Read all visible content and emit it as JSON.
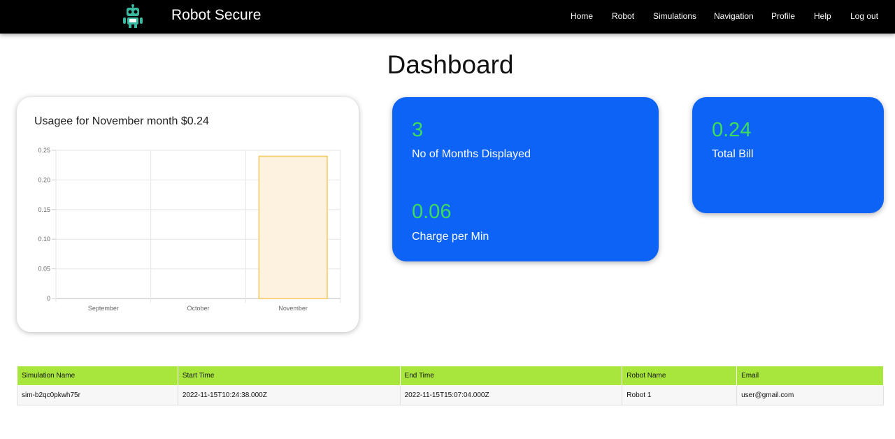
{
  "navbar": {
    "brand": "Robot Secure",
    "links": [
      "Home",
      "Robot",
      "Simulations",
      "Navigation",
      "Profile",
      "Help",
      "Log out"
    ]
  },
  "page_title": "Dashboard",
  "usage_card": {
    "title": "Usagee for November month $0.24"
  },
  "chart_data": {
    "type": "bar",
    "categories": [
      "September",
      "October",
      "November"
    ],
    "values": [
      0,
      0,
      0.24
    ],
    "ylim": [
      0,
      0.25
    ],
    "y_ticks": [
      "0",
      "0.05",
      "0.10",
      "0.15",
      "0.20",
      "0.25"
    ],
    "y_tick_values": [
      0,
      0.05,
      0.1,
      0.15,
      0.2,
      0.25
    ],
    "grid": true,
    "bar_fill": "#fdf2df",
    "bar_border": "#f5c85a"
  },
  "stats": {
    "months_value": "3",
    "months_label": "No of Months Displayed",
    "charge_value": "0.06",
    "charge_label": "Charge per Min",
    "bill_value": "0.24",
    "bill_label": "Total Bill"
  },
  "colors": {
    "card_blue": "#0c63f5",
    "stat_green": "#3ddc5a",
    "table_header": "#a8e63d",
    "logo_teal": "#3ab9a0"
  },
  "table": {
    "headers": [
      "Simulation Name",
      "Start Time",
      "End Time",
      "Robot Name",
      "Email"
    ],
    "rows": [
      [
        "sim-b2qc0pkwh75r",
        "2022-11-15T10:24:38.000Z",
        "2022-11-15T15:07:04.000Z",
        "Robot 1",
        "user@gmail.com"
      ]
    ]
  }
}
